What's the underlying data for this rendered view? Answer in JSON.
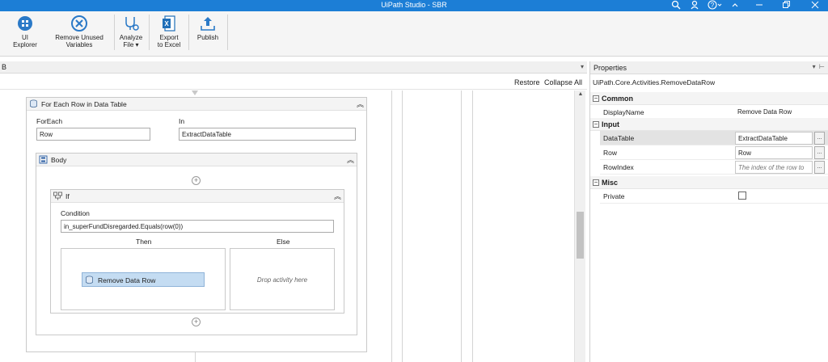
{
  "window": {
    "title": "UiPath Studio - SBR"
  },
  "ribbon": {
    "buttons": [
      {
        "label_line1": "UI",
        "label_line2": "Explorer",
        "icon": "ui-explorer-icon"
      },
      {
        "label_line1": "Remove Unused",
        "label_line2": "Variables",
        "icon": "remove-unused-icon"
      },
      {
        "label_line1": "Analyze",
        "label_line2": "File ▾",
        "icon": "analyze-file-icon"
      },
      {
        "label_line1": "Export",
        "label_line2": "to Excel",
        "icon": "excel-icon"
      },
      {
        "label_line1": "Publish",
        "label_line2": "",
        "icon": "publish-icon"
      }
    ]
  },
  "designer": {
    "tab_label": "B",
    "restore_label": "Restore",
    "collapse_all_label": "Collapse All",
    "foreach_activity": {
      "title": "For Each Row in Data Table",
      "foreach_label": "ForEach",
      "foreach_value": "Row",
      "in_label": "In",
      "in_value": "ExtractDataTable"
    },
    "body": {
      "title": "Body"
    },
    "if_activity": {
      "title": "If",
      "condition_label": "Condition",
      "condition_value": "in_superFundDisregarded.Equals(row(0))",
      "then_label": "Then",
      "else_label": "Else",
      "then_activity": "Remove Data Row",
      "else_placeholder": "Drop activity here"
    }
  },
  "properties": {
    "title": "Properties",
    "type_name": "UiPath.Core.Activities.RemoveDataRow",
    "categories": {
      "common": "Common",
      "input": "Input",
      "misc": "Misc"
    },
    "rows": {
      "display_name": {
        "key": "DisplayName",
        "value": "Remove Data Row"
      },
      "data_table": {
        "key": "DataTable",
        "value": "ExtractDataTable"
      },
      "row": {
        "key": "Row",
        "value": "Row"
      },
      "row_index": {
        "key": "RowIndex",
        "placeholder": "The index of the row to"
      },
      "private": {
        "key": "Private",
        "checked": false
      }
    }
  }
}
